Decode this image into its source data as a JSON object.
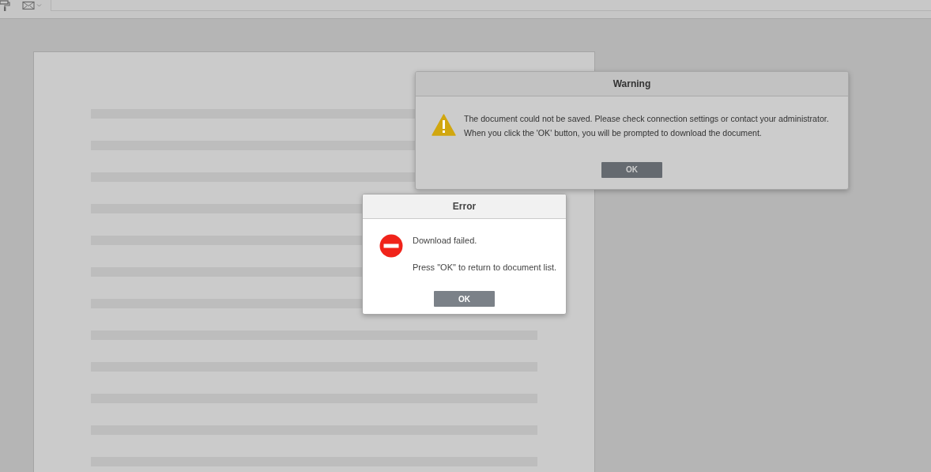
{
  "dialogs": [
    {
      "kind": "warning",
      "title": "Warning",
      "messages": [
        "The document could not be saved. Please check connection settings or contact your administrator.",
        "When you click the 'OK' button, you will be prompted to download the document."
      ],
      "button": "OK"
    },
    {
      "kind": "error",
      "title": "Error",
      "messages": [
        "Download failed.",
        "Press \"OK\" to return to document list."
      ],
      "button": "OK"
    }
  ]
}
